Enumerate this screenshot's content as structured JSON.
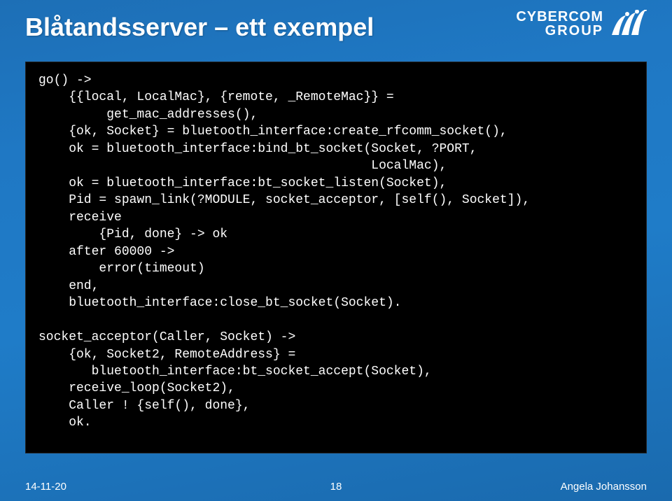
{
  "header": {
    "title": "Blåtandsserver – ett exempel",
    "logo_line1": "CYBERCOM",
    "logo_line2": "GROUP"
  },
  "code": "go() ->\n    {{local, LocalMac}, {remote, _RemoteMac}} =\n         get_mac_addresses(),\n    {ok, Socket} = bluetooth_interface:create_rfcomm_socket(),\n    ok = bluetooth_interface:bind_bt_socket(Socket, ?PORT,\n                                            LocalMac),\n    ok = bluetooth_interface:bt_socket_listen(Socket),\n    Pid = spawn_link(?MODULE, socket_acceptor, [self(), Socket]),\n    receive\n        {Pid, done} -> ok\n    after 60000 ->\n        error(timeout)\n    end,\n    bluetooth_interface:close_bt_socket(Socket).\n\nsocket_acceptor(Caller, Socket) ->\n    {ok, Socket2, RemoteAddress} =\n       bluetooth_interface:bt_socket_accept(Socket),\n    receive_loop(Socket2),\n    Caller ! {self(), done},\n    ok.",
  "footer": {
    "date": "14-11-20",
    "page": "18",
    "author": "Angela Johansson"
  }
}
